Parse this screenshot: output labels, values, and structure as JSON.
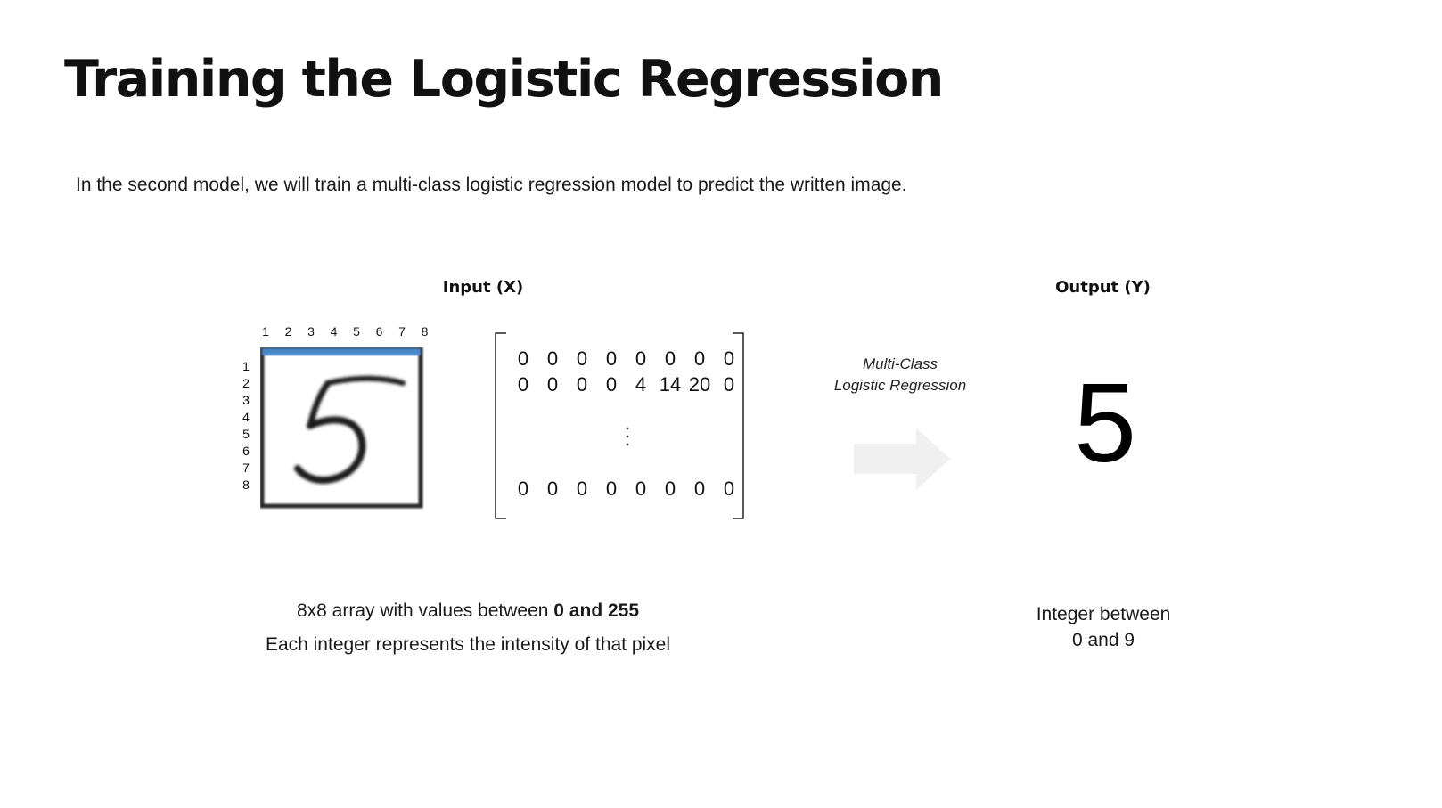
{
  "slide": {
    "title": "Training the Logistic Regression",
    "subtitle": "In the second model, we will train a multi-class logistic regression model to predict the written image."
  },
  "input": {
    "heading": "Input (X)",
    "column_indices": [
      "1",
      "2",
      "3",
      "4",
      "5",
      "6",
      "7",
      "8"
    ],
    "row_indices": [
      "1",
      "2",
      "3",
      "4",
      "5",
      "6",
      "7",
      "8"
    ],
    "digit_image_icon": "handwritten-digit-5",
    "matrix": {
      "row_0": [
        "0",
        "0",
        "0",
        "0",
        "0",
        "0",
        "0",
        "0"
      ],
      "row_1": [
        "0",
        "0",
        "0",
        "0",
        "4",
        "14",
        "20",
        "0"
      ],
      "ellipsis": "⋮",
      "row_last": [
        "0",
        "0",
        "0",
        "0",
        "0",
        "0",
        "0",
        "0"
      ]
    },
    "caption_line1_prefix": "8x8 array with values between ",
    "caption_line1_bold": "0 and 255",
    "caption_line2": "Each integer represents the intensity of that pixel"
  },
  "model": {
    "label_line1": "Multi-Class",
    "label_line2": "Logistic Regression",
    "arrow_icon": "right-arrow-icon",
    "arrow_color": "#f0f0f0"
  },
  "output": {
    "heading": "Output (Y)",
    "value": "5",
    "caption_line1": "Integer between",
    "caption_line2": "0 and 9"
  }
}
